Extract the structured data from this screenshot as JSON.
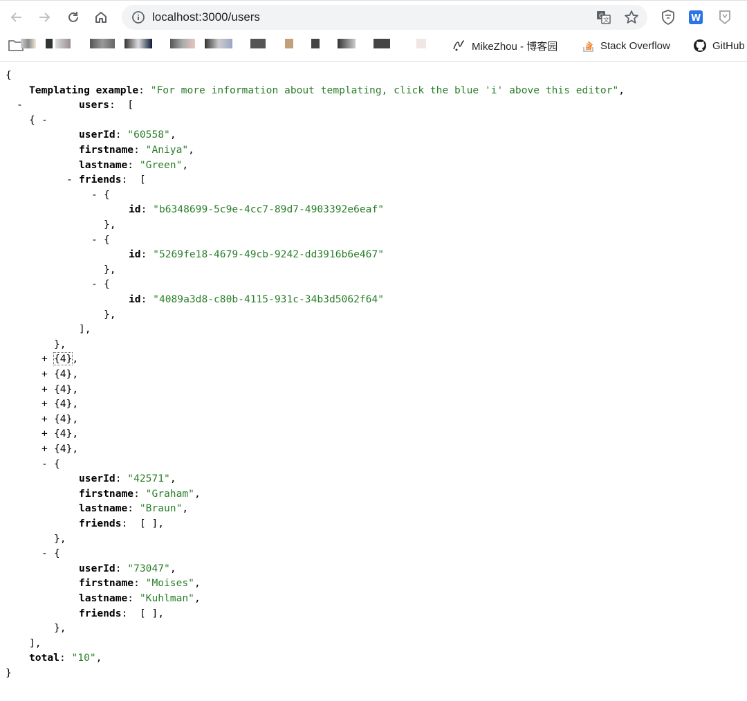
{
  "browser": {
    "url": "localhost:3000/users",
    "bookmarks": [
      {
        "label": "MikeZhou - 博客园"
      },
      {
        "label": "Stack Overflow"
      },
      {
        "label": "GitHub"
      }
    ]
  },
  "json_lines": [
    {
      "t": "{"
    },
    {
      "k": "Templating example",
      "s": "\"For more information about templating, click the blue 'i' above this editor\"",
      "p": ","
    },
    {
      "tog": "-",
      "k": "users",
      "p": " ["
    },
    {
      "tog": "-",
      "t": "{"
    },
    {
      "k": "userId",
      "s": "\"60558\"",
      "p": ","
    },
    {
      "k": "firstname",
      "s": "\"Aniya\"",
      "p": ","
    },
    {
      "k": "lastname",
      "s": "\"Green\"",
      "p": ","
    },
    {
      "tog": "-",
      "k": "friends",
      "p": " ["
    },
    {
      "tog": "-",
      "t": "{"
    },
    {
      "k": "id",
      "s": "\"b6348699-5c9e-4cc7-89d7-4903392e6eaf\""
    },
    {
      "t": "},"
    },
    {
      "tog": "-",
      "t": "{"
    },
    {
      "k": "id",
      "s": "\"5269fe18-4679-49cb-9242-dd3916b6e467\""
    },
    {
      "t": "},"
    },
    {
      "tog": "-",
      "t": "{"
    },
    {
      "k": "id",
      "s": "\"4089a3d8-c80b-4115-931c-34b3d5062f64\""
    },
    {
      "t": "},"
    },
    {
      "t": "],"
    },
    {
      "t": "},"
    },
    {
      "tog": "+",
      "t": "{4},"
    },
    {
      "tog": "+",
      "t": "{4},"
    },
    {
      "tog": "+",
      "t": "{4},"
    },
    {
      "tog": "+",
      "t": "{4},"
    },
    {
      "tog": "+",
      "t": "{4},"
    },
    {
      "tog": "+",
      "t": "{4},"
    },
    {
      "tog": "+",
      "t": "{4},"
    },
    {
      "tog": "-",
      "t": "{"
    },
    {
      "k": "userId",
      "s": "\"42571\"",
      "p": ","
    },
    {
      "k": "firstname",
      "s": "\"Graham\"",
      "p": ","
    },
    {
      "k": "lastname",
      "s": "\"Braun\"",
      "p": ","
    },
    {
      "k": "friends",
      "p": " [ ],"
    },
    {
      "t": "},"
    },
    {
      "tog": "-",
      "t": "{"
    },
    {
      "k": "userId",
      "s": "\"73047\"",
      "p": ","
    },
    {
      "k": "firstname",
      "s": "\"Moises\"",
      "p": ","
    },
    {
      "k": "lastname",
      "s": "\"Kuhlman\"",
      "p": ","
    },
    {
      "k": "friends",
      "p": " [ ],"
    },
    {
      "t": "},"
    },
    {
      "t": "],"
    },
    {
      "k": "total",
      "s": "\"10\"",
      "p": ","
    },
    {
      "t": "}"
    }
  ]
}
